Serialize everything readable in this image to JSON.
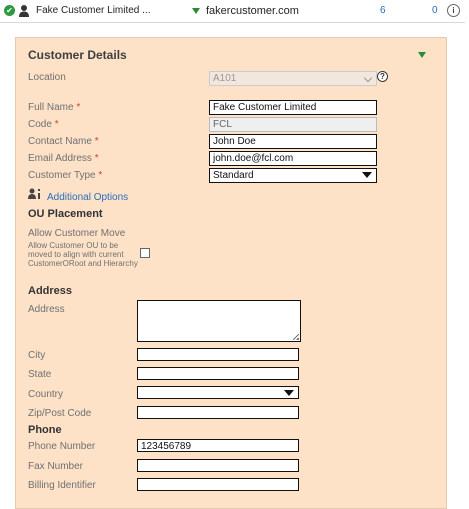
{
  "row": {
    "name": "Fake Customer Limited ...",
    "domain": "fakercustomer.com",
    "count1": "6",
    "count2": "0"
  },
  "panel": {
    "title": "Customer Details",
    "location": {
      "label": "Location",
      "value": "A101"
    },
    "full_name": {
      "label": "Full Name",
      "value": "Fake Customer Limited"
    },
    "code": {
      "label": "Code",
      "value": "FCL"
    },
    "contact_name": {
      "label": "Contact Name",
      "value": "John Doe"
    },
    "email": {
      "label": "Email Address",
      "value": "john.doe@fcl.com"
    },
    "customer_type": {
      "label": "Customer Type",
      "value": "Standard"
    },
    "required_marker": "*",
    "additional_options": "Additional Options",
    "ou_placement": "OU Placement",
    "allow_move": "Allow Customer Move",
    "allow_move_desc": "Allow Customer OU to be moved to align with current CustomerORoot and Hierarchy",
    "address_heading": "Address",
    "address": {
      "label": "Address",
      "value": ""
    },
    "city": {
      "label": "City",
      "value": ""
    },
    "state": {
      "label": "State",
      "value": ""
    },
    "country": {
      "label": "Country",
      "value": ""
    },
    "zip": {
      "label": "Zip/Post Code",
      "value": ""
    },
    "phone_heading": "Phone",
    "phone": {
      "label": "Phone Number",
      "value": "123456789"
    },
    "fax": {
      "label": "Fax Number",
      "value": ""
    },
    "billing": {
      "label": "Billing Identifier",
      "value": ""
    }
  }
}
